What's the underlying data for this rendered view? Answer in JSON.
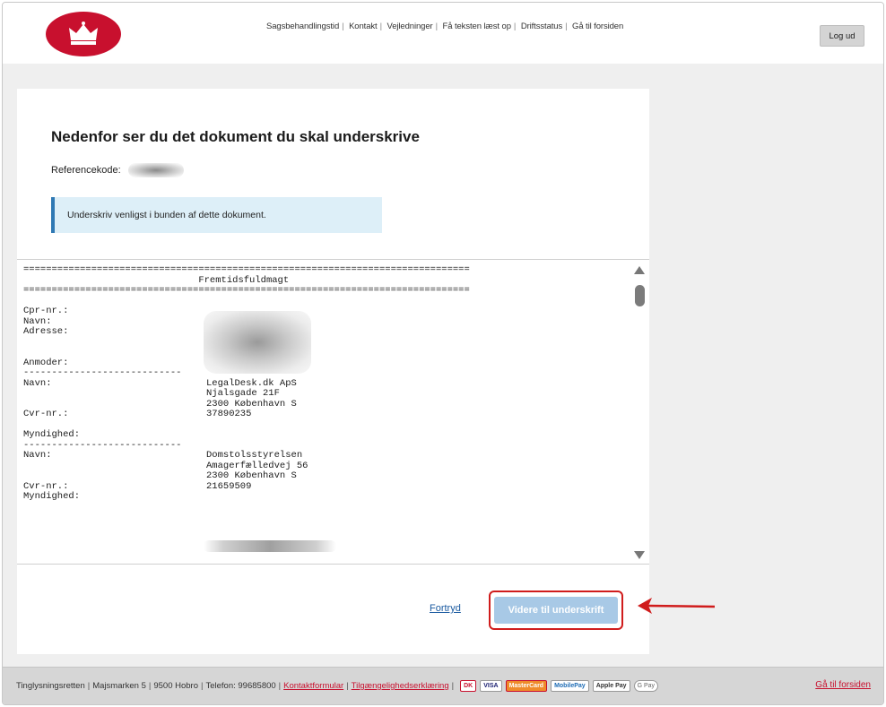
{
  "header": {
    "nav": [
      "Sagsbehandlingstid",
      "Kontakt",
      "Vejledninger",
      "Få teksten læst op",
      "Driftsstatus",
      "Gå til forsiden"
    ],
    "logout_label": "Log ud"
  },
  "page": {
    "title": "Nedenfor ser du det dokument du skal underskrive",
    "reference_label": "Referencekode:",
    "notice": "Underskriv venligst i bunden af dette dokument."
  },
  "document": {
    "rule": "===============================================================================",
    "heading": "                               Fremtidsfuldmagt",
    "cpr_label": "Cpr-nr.:",
    "name_label": "Navn:",
    "address_label": "Adresse:",
    "requester_label": "Anmoder:",
    "dash": "----------------------------",
    "requester": {
      "name_label": "Navn:",
      "company": "LegalDesk.dk ApS",
      "street": "Njalsgade 21F",
      "city": "2300 København S",
      "cvr_label": "Cvr-nr.:",
      "cvr": "37890235"
    },
    "authority_label": "Myndighed:",
    "authority": {
      "name_label": "Navn:",
      "name": "Domstolsstyrelsen",
      "street": "Amagerfælledvej 56",
      "city": "2300 København S",
      "cvr_label": "Cvr-nr.:",
      "cvr": "21659509",
      "sub_label": "Myndighed:"
    }
  },
  "actions": {
    "cancel_label": "Fortryd",
    "proceed_label": "Videre til underskrift"
  },
  "footer": {
    "org": "Tinglysningsretten",
    "address": "Majsmarken 5",
    "city": "9500 Hobro",
    "phone": "Telefon: 99685800",
    "contact_link": "Kontaktformular",
    "access_link": "Tilgængelighedserklæring",
    "payments": [
      "DK",
      "VISA",
      "MasterCard",
      "MobilePay",
      "Apple Pay",
      "G Pay"
    ],
    "home_link": "Gå til forsiden"
  },
  "colors": {
    "brand_red": "#c8102e",
    "notice_bg": "#ddeff8",
    "notice_border": "#2f79b4",
    "proceed_bg": "#a8c9e6",
    "highlight": "#d01c1c"
  }
}
